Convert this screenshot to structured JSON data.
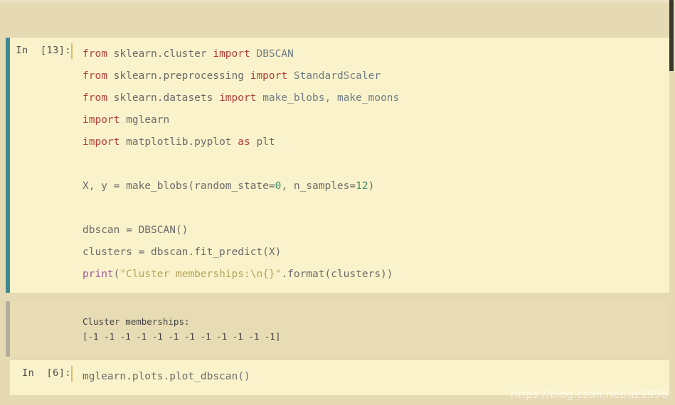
{
  "scrollbar": {
    "thumb_top": 0,
    "thumb_height": 100,
    "thumb_color": "#3a372f"
  },
  "colors": {
    "page_background": "#e6dab4",
    "code_cell_background": "#faf2ca",
    "output_background": "#e8dcb5",
    "selected_marker": "#3d8a93",
    "output_marker": "#b5ae9b",
    "cursor": "#d8bb6a",
    "keyword": "#b5403b",
    "builtin": "#9b5a9b",
    "string": "#b2a55c",
    "number": "#3f8f6f",
    "class_name": "#6f7d86",
    "identifier": "#6b6b6b"
  },
  "cells": [
    {
      "prompt": "In  [13]:",
      "selected": true,
      "code_lines": [
        "from sklearn.cluster import DBSCAN",
        "from sklearn.preprocessing import StandardScaler",
        "from sklearn.datasets import make_blobs, make_moons",
        "import mglearn",
        "import matplotlib.pyplot as plt",
        "",
        "X, y = make_blobs(random_state=0, n_samples=12)",
        "",
        "dbscan = DBSCAN()",
        "clusters = dbscan.fit_predict(X)",
        "print(\"Cluster memberships:\\n{}\".format(clusters))"
      ],
      "tokens": {
        "l1": {
          "kw1": "from",
          "mod1": "sklearn.cluster",
          "kw2": "import",
          "cls": "DBSCAN"
        },
        "l2": {
          "kw1": "from",
          "mod1": "sklearn.preprocessing",
          "kw2": "import",
          "cls": "StandardScaler"
        },
        "l3": {
          "kw1": "from",
          "mod1": "sklearn.datasets",
          "kw2": "import",
          "cls": "make_blobs, make_moons"
        },
        "l4": {
          "kw1": "import",
          "mod1": "mglearn"
        },
        "l5": {
          "kw1": "import",
          "mod1": "matplotlib.pyplot",
          "kw2": "as",
          "cls": "plt"
        },
        "l7": {
          "lhs": "X, y = make_blobs(random_state=",
          "n1": "0",
          "mid": ", n_samples=",
          "n2": "12",
          "rhs": ")"
        },
        "l9": {
          "text": "dbscan = DBSCAN()"
        },
        "l10": {
          "text": "clusters = dbscan.fit_predict(X)"
        },
        "l11": {
          "fn": "print",
          "open": "(",
          "str": "\"Cluster memberships:\\n{}\"",
          "rest": ".format(clusters))"
        }
      },
      "output": {
        "marker_style": "output",
        "lines": [
          "Cluster memberships:",
          "[-1 -1 -1 -1 -1 -1 -1 -1 -1 -1 -1 -1]"
        ]
      }
    },
    {
      "prompt": "In  [6]:",
      "selected": false,
      "code_lines": [
        "mglearn.plots.plot_dbscan()"
      ],
      "tokens": {
        "l1": {
          "text": "mglearn.plots.plot_dbscan()"
        }
      }
    }
  ],
  "watermark": {
    "text": "https://blog.csdn.net/az9996"
  }
}
